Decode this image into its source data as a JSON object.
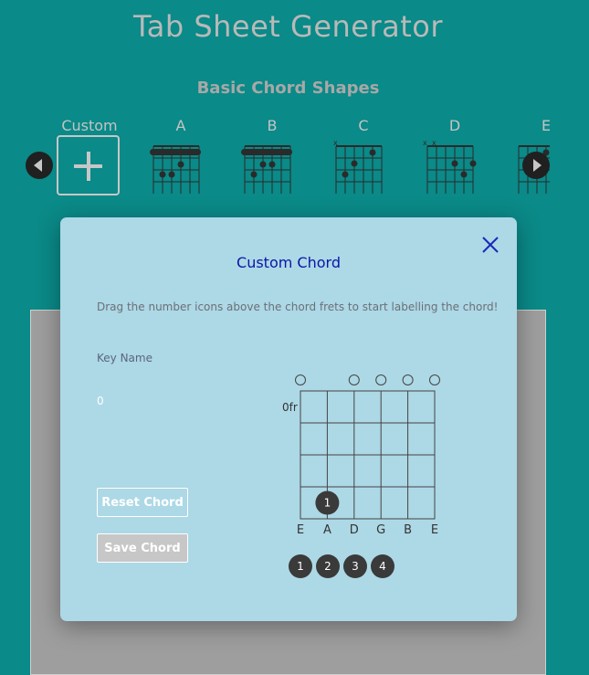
{
  "app": {
    "title": "Tab Sheet Generator"
  },
  "chord_shapes": {
    "section_title": "Basic Chord Shapes",
    "cards": [
      {
        "label": "Custom"
      },
      {
        "label": "A"
      },
      {
        "label": "B"
      },
      {
        "label": "C"
      },
      {
        "label": "D"
      },
      {
        "label": "E"
      }
    ]
  },
  "modal": {
    "title": "Custom Chord",
    "instructions": "Drag the number icons above the chord frets to start labelling the chord!",
    "key_name_label": "Key Name",
    "key_name_value": "0",
    "reset_label": "Reset Chord",
    "save_label": "Save Chord",
    "fretboard": {
      "fret_start_label": "0fr",
      "strings": [
        "E",
        "A",
        "D",
        "G",
        "B",
        "E"
      ],
      "open_markers": [
        "E",
        "D",
        "G",
        "B",
        "E"
      ],
      "placed_fingers": [
        {
          "finger": "1",
          "string": "A",
          "fret": 4
        }
      ]
    },
    "finger_tokens": [
      "1",
      "2",
      "3",
      "4"
    ]
  },
  "colors": {
    "background": "#0a8a88",
    "modal": "#add8e6",
    "title_accent": "#0a16a6",
    "token": "#3a3a3a"
  }
}
